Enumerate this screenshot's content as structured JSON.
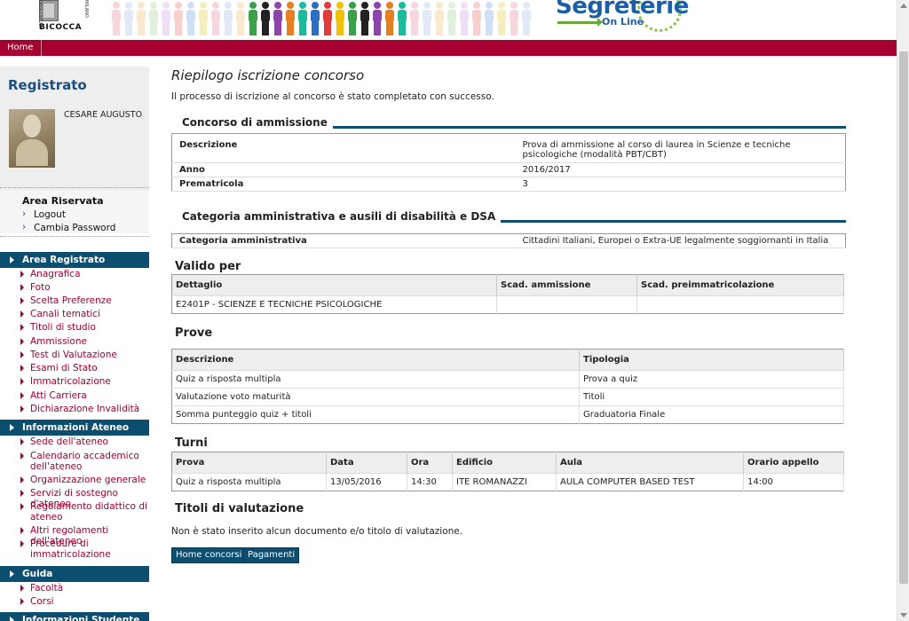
{
  "header": {
    "logo_text": "BICOCCA",
    "logo_small_1": "DEGLI STUDI",
    "logo_small_2": "MILANO",
    "segreterie_word": "Segreterie",
    "segreterie_online": "On Line"
  },
  "topnav": {
    "home": "Home"
  },
  "sidebar": {
    "title": "Registrato",
    "user": "CESARE AUGUSTO",
    "area_riservata": {
      "title": "Area Riservata",
      "links": [
        "Logout",
        "Cambia Password"
      ]
    },
    "sections": [
      {
        "title": "Area Registrato",
        "links": [
          "Anagrafica",
          "Foto",
          "Scelta Preferenze",
          "Canali tematici",
          "Titoli di studio",
          "Ammissione",
          "Test di Valutazione",
          "Esami di Stato",
          "Immatricolazione",
          "Atti Carriera",
          "Dichiarazione Invalidità"
        ]
      },
      {
        "title": "Informazioni Ateneo",
        "links": [
          "Sede dell'ateneo",
          "Calendario accademico dell'ateneo",
          "Organizzazione generale",
          "Servizi di sostegno d'ateneo",
          "Regolamento didattico di ateneo",
          "Altri regolamenti dell'ateneo",
          "Procedure di immatricolazione"
        ]
      },
      {
        "title": "Guida",
        "links": [
          "Facoltà",
          "Corsi"
        ]
      },
      {
        "title": "Informazioni Studente",
        "links": []
      }
    ]
  },
  "main": {
    "title": "Riepilogo iscrizione concorso",
    "intro": "Il processo di iscrizione al concorso è stato completato con successo.",
    "concorso": {
      "section_title": "Concorso di ammissione",
      "rows": [
        {
          "key": "Descrizione",
          "value": "Prova di ammissione al corso di laurea in Scienze e tecniche psicologiche (modalità PBT/CBT)"
        },
        {
          "key": "Anno",
          "value": "2016/2017"
        },
        {
          "key": "Prematricola",
          "value": "3"
        }
      ]
    },
    "categoria": {
      "section_title": "Categoria amministrativa e ausili di disabilità e DSA",
      "rows": [
        {
          "key": "Categoria amministrativa",
          "value": "Cittadini Italiani, Europei o Extra-UE legalmente soggiornanti in Italia"
        }
      ]
    },
    "valido_per": {
      "title": "Valido per",
      "headers": [
        "Dettaglio",
        "Scad. ammissione",
        "Scad. preimmatricolazione"
      ],
      "rows": [
        [
          "E2401P - SCIENZE E TECNICHE PSICOLOGICHE",
          "",
          ""
        ]
      ]
    },
    "prove": {
      "title": "Prove",
      "headers": [
        "Descrizione",
        "Tipologia"
      ],
      "rows": [
        [
          "Quiz a risposta multipla",
          "Prova a quiz"
        ],
        [
          "Valutazione voto maturità",
          "Titoli"
        ],
        [
          "Somma punteggio quiz + titoli",
          "Graduatoria Finale"
        ]
      ]
    },
    "turni": {
      "title": "Turni",
      "headers": [
        "Prova",
        "Data",
        "Ora",
        "Edificio",
        "Aula",
        "Orario appello"
      ],
      "rows": [
        [
          "Quiz a risposta multipla",
          "13/05/2016",
          "14:30",
          "ITE ROMANAZZI",
          "AULA COMPUTER BASED TEST",
          "14:00"
        ]
      ]
    },
    "titoli": {
      "title": "Titoli di valutazione",
      "empty_text": "Non è stato inserito alcun documento e/o titolo di valutazione."
    },
    "buttons": {
      "home_concorsi": "Home concorsi",
      "pagamenti": "Pagamenti"
    }
  },
  "colors": {
    "brand_red": "#a50030",
    "section_blue": "#0b4e6f",
    "title_blue": "#1b4d7e"
  }
}
